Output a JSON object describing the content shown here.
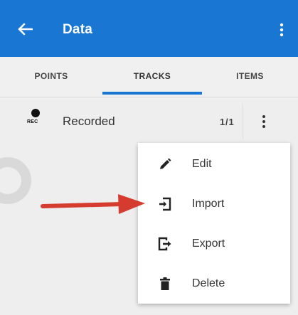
{
  "appbar": {
    "title": "Data",
    "color": "#1976d2"
  },
  "tabs": [
    {
      "label": "POINTS",
      "active": false
    },
    {
      "label": "TRACKS",
      "active": true
    },
    {
      "label": "ITEMS",
      "active": false
    }
  ],
  "track_row": {
    "icon_text": "REC",
    "label": "Recorded",
    "count": "1/1"
  },
  "context_menu": {
    "items": [
      {
        "label": "Edit",
        "icon": "pencil-icon"
      },
      {
        "label": "Import",
        "icon": "import-icon"
      },
      {
        "label": "Export",
        "icon": "export-icon"
      },
      {
        "label": "Delete",
        "icon": "trash-icon"
      }
    ]
  },
  "annotation": {
    "arrow_color": "#d63b2f",
    "points_to": "Import"
  }
}
